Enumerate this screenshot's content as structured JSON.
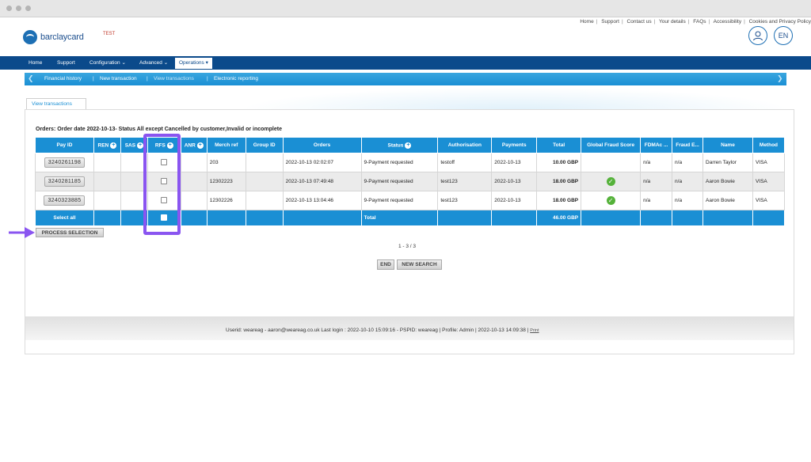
{
  "top_links": [
    "Home",
    "Support",
    "Contact us",
    "Your details",
    "FAQs",
    "Accessibility",
    "Cookies and Privacy Policy"
  ],
  "brand": {
    "name": "barclaycard",
    "env_badge": "TEST",
    "lang": "EN"
  },
  "main_nav": [
    {
      "label": "Home"
    },
    {
      "label": "Support"
    },
    {
      "label": "Configuration ⌄"
    },
    {
      "label": "Advanced ⌄"
    },
    {
      "label": "Operations ▾"
    }
  ],
  "sub_nav": [
    {
      "label": "Financial history"
    },
    {
      "label": "New transaction"
    },
    {
      "label": "View transactions"
    },
    {
      "label": "Electronic reporting"
    }
  ],
  "tab_label": "View transactions",
  "orders_title": "Orders: Order date 2022-10-13- Status All except Cancelled by customer,Invalid or incomplete",
  "table": {
    "headers": [
      "Pay ID",
      "REN",
      "SAS",
      "RFS",
      "ANR",
      "Merch ref",
      "Group ID",
      "Orders",
      "Status",
      "Authorisation",
      "Payments",
      "Total",
      "Global Fraud Score",
      "FDMAc ...",
      "Fraud E...",
      "Name",
      "Method"
    ],
    "rows": [
      {
        "pay_id": "3240261198",
        "merch_ref": "203",
        "orders": "2022-10-13 02:02:07",
        "status": "9-Payment requested",
        "auth": "testoff",
        "payments": "2022-10-13",
        "total": "10.00 GBP",
        "fdmac": "n/a",
        "fraud": "n/a",
        "name": "Darren Taylor",
        "method": "VISA"
      },
      {
        "pay_id": "3240281185",
        "merch_ref": "12302223",
        "orders": "2022-10-13 07:49:48",
        "status": "9-Payment requested",
        "auth": "test123",
        "payments": "2022-10-13",
        "total": "18.00 GBP",
        "fdmac": "n/a",
        "fraud": "n/a",
        "name": "Aaron Bowie",
        "method": "VISA"
      },
      {
        "pay_id": "3240323885",
        "merch_ref": "12302226",
        "orders": "2022-10-13 13:04:46",
        "status": "9-Payment requested",
        "auth": "test123",
        "payments": "2022-10-13",
        "total": "18.00 GBP",
        "fdmac": "n/a",
        "fraud": "n/a",
        "name": "Aaron Bowie",
        "method": "VISA"
      }
    ],
    "select_all": "Select all",
    "total_label": "Total",
    "total_value": "46.00 GBP"
  },
  "process_btn": "PROCESS SELECTION",
  "pager_text": "1 - 3 / 3",
  "end_btn": "END",
  "new_search_btn": "NEW SEARCH",
  "footer": {
    "status": "Userid: weareag - aaron@weareag.co.uk Last login : 2022-10-10 15:09:16 - PSPID: weareag | Profile: Admin | 2022-10-13 14:09:38 |",
    "print": "Print"
  },
  "colors": {
    "nav": "#0b4a8b",
    "accent": "#1a8fd4",
    "highlight": "#8a55f0",
    "ok": "#55b23a"
  }
}
